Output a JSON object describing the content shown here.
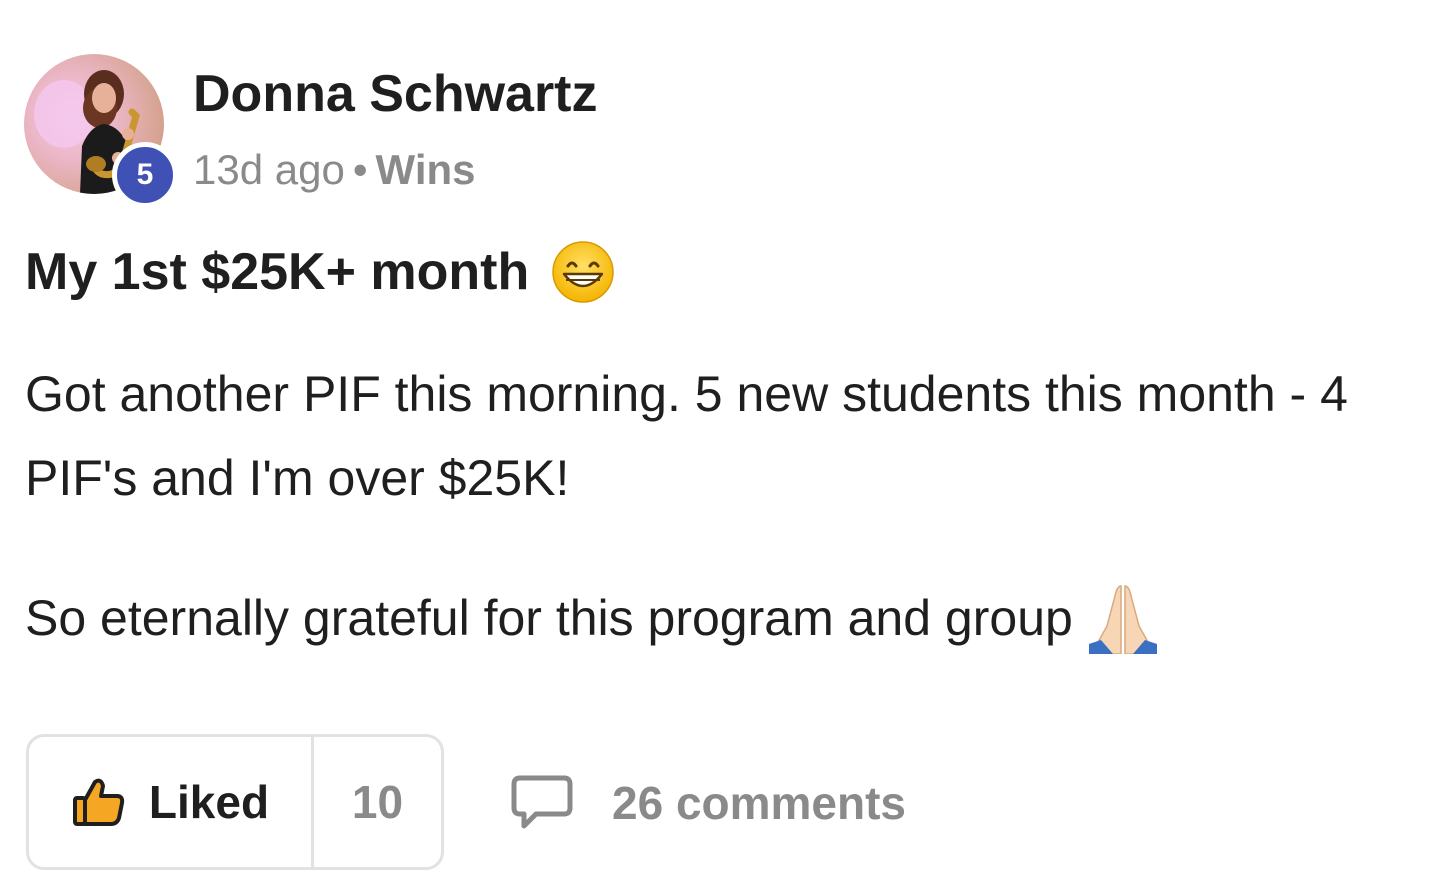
{
  "post": {
    "author": {
      "name": "Donna Schwartz",
      "level": "5",
      "avatar_icon": "avatar-photo"
    },
    "meta": {
      "time": "13d ago",
      "separator": "•",
      "category": "Wins"
    },
    "title": "My 1st $25K+ month",
    "title_emoji": "grinning-face-emoji",
    "body": {
      "paragraph1": "Got another PIF this morning. 5 new students this month - 4 PIF's and I'm over $25K!",
      "paragraph2": "So eternally grateful for this program and group",
      "paragraph2_emoji": "folded-hands-emoji"
    },
    "actions": {
      "like_label": "Liked",
      "like_icon": "thumbs-up-icon",
      "like_count": "10",
      "comments_label": "26 comments",
      "comments_icon": "comment-bubble-icon"
    }
  },
  "colors": {
    "badge": "#3f51b5",
    "text_primary": "#1f1f1f",
    "text_secondary": "#8a8a8a",
    "border": "#e2e2e2"
  }
}
